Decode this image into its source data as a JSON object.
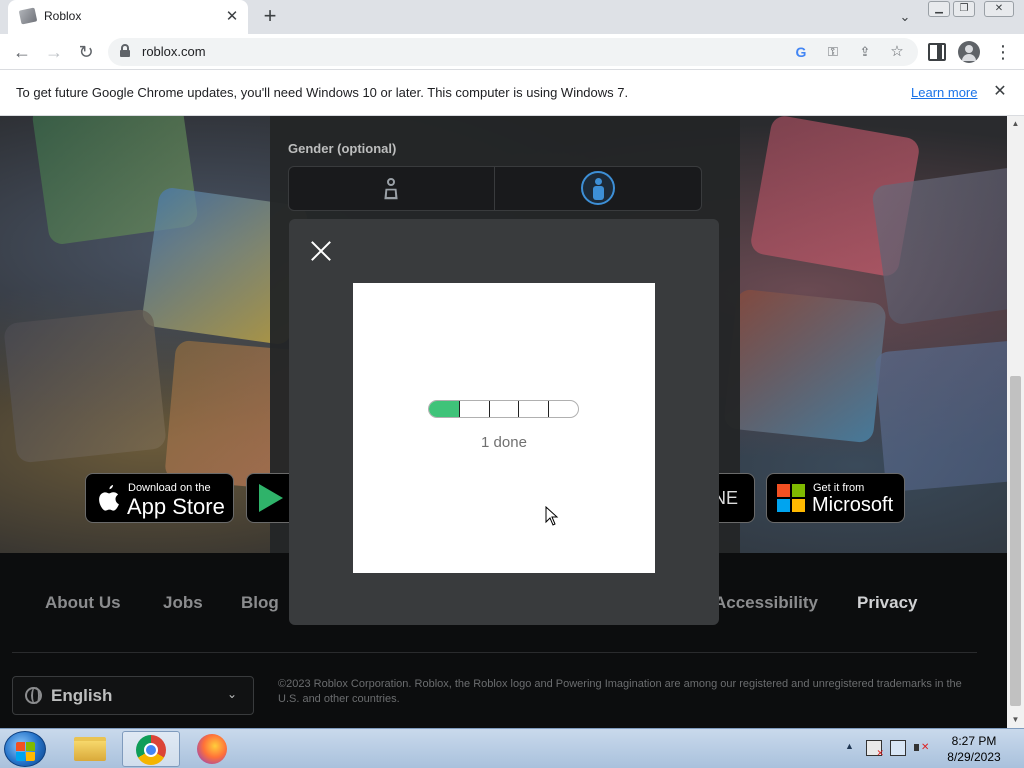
{
  "browser": {
    "tab_title": "Roblox",
    "url": "roblox.com",
    "icons": [
      "back-icon",
      "forward-icon",
      "reload-icon",
      "lock-icon",
      "google-icon",
      "key-icon",
      "share-icon",
      "star-icon",
      "side-panel-icon",
      "profile-icon",
      "menu-icon"
    ]
  },
  "infobar": {
    "text": "To get future Google Chrome updates, you'll need Windows 10 or later. This computer is using Windows 7.",
    "link": "Learn more"
  },
  "signup": {
    "gender_label": "Gender (optional)",
    "selected_gender": "male"
  },
  "stores": {
    "appstore_small": "Download on the",
    "appstore_big": "App Store",
    "amazon_partial": "NE",
    "microsoft_small": "Get it from",
    "microsoft_big": "Microsoft"
  },
  "footer": {
    "links": {
      "about": "About Us",
      "jobs": "Jobs",
      "blog": "Blog",
      "accessibility": "Accessibility",
      "privacy": "Privacy"
    },
    "language": "English",
    "copyright": "©2023 Roblox Corporation. Roblox, the Roblox logo and Powering Imagination are among our registered and unregistered trademarks in the U.S. and other countries."
  },
  "modal": {
    "progress_text": "1 done",
    "progress_fraction": 0.2,
    "segments": 5
  },
  "taskbar": {
    "apps": [
      "windows-explorer",
      "google-chrome",
      "firefox"
    ],
    "time": "8:27 PM",
    "date": "8/29/2023"
  },
  "colors": {
    "progress_fill": "#3fc379",
    "accent_blue": "#3d8fd6",
    "link_blue": "#1a73e8"
  }
}
